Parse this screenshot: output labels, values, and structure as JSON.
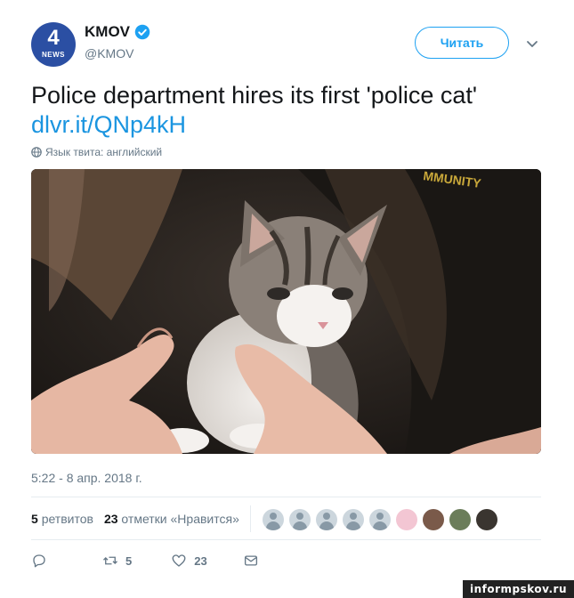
{
  "account": {
    "name": "KMOV",
    "handle": "@KMOV",
    "avatar_number": "4",
    "avatar_network": "NEWS",
    "verified": true
  },
  "follow_button": {
    "label": "Читать"
  },
  "tweet": {
    "text": "Police department hires its first 'police cat'",
    "link": "dlvr.it/QNp4kH",
    "language_note": "Язык твита: английский",
    "media_alt": "kitten held in hands",
    "timestamp": "5:22 - 8 апр. 2018 г."
  },
  "stats": {
    "retweets_count": "5",
    "retweets_label": "ретвитов",
    "likes_count": "23",
    "likes_label": "отметки «Нравится»"
  },
  "likers": [
    {
      "type": "default",
      "name": "default-avatar-icon"
    },
    {
      "type": "default",
      "name": "default-avatar-icon"
    },
    {
      "type": "default",
      "name": "default-avatar-icon"
    },
    {
      "type": "default",
      "name": "default-avatar-icon"
    },
    {
      "type": "default",
      "name": "default-avatar-icon"
    },
    {
      "type": "image",
      "name": "hello-kitty-avatar",
      "color": "#f3c6d3"
    },
    {
      "type": "image",
      "name": "photo-avatar",
      "color": "#7a5a4a"
    },
    {
      "type": "image",
      "name": "cartoon-avatar",
      "color": "#6b7d5a"
    },
    {
      "type": "image",
      "name": "photo-avatar-2",
      "color": "#3a3530"
    }
  ],
  "actions": {
    "reply_icon": "reply-icon",
    "retweet_count": "5",
    "like_count": "23",
    "message_icon": "message-icon"
  },
  "colors": {
    "accent": "#1da1f2",
    "link": "#1b95e0",
    "muted": "#657786",
    "avatar_bg": "#2b4fa3"
  },
  "watermark": "informpskov.ru"
}
